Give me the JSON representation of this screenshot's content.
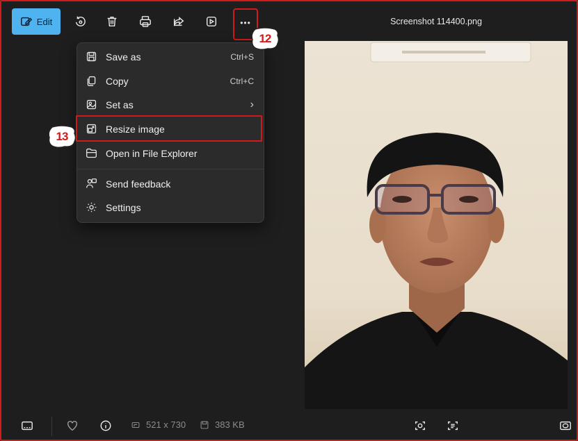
{
  "toolbar": {
    "edit_label": "Edit",
    "buttons": [
      "rotate-icon",
      "delete-icon",
      "print-icon",
      "share-icon",
      "slideshow-icon",
      "more-icon"
    ],
    "more_label": "•••"
  },
  "window": {
    "title": "Screenshot 114400.png"
  },
  "menu": {
    "items": [
      {
        "label": "Save as",
        "shortcut": "Ctrl+S",
        "icon": "save-icon"
      },
      {
        "label": "Copy",
        "shortcut": "Ctrl+C",
        "icon": "copy-icon"
      },
      {
        "label": "Set as",
        "shortcut": "›",
        "icon": "set-as-icon"
      },
      {
        "label": "Resize image",
        "shortcut": "",
        "icon": "resize-icon"
      },
      {
        "label": "Open in File Explorer",
        "shortcut": "",
        "icon": "folder-icon"
      },
      {
        "label": "Send feedback",
        "shortcut": "",
        "icon": "feedback-icon"
      },
      {
        "label": "Settings",
        "shortcut": "",
        "icon": "gear-icon"
      }
    ]
  },
  "annotations": {
    "step_a": "12",
    "step_b": "13"
  },
  "statusbar": {
    "dimensions": "521 x 730",
    "filesize": "383 KB"
  },
  "colors": {
    "accent": "#4fb3f0",
    "highlight_border": "#d11a1a",
    "background": "#1e1e1e",
    "menu_bg": "#2b2b2b"
  }
}
